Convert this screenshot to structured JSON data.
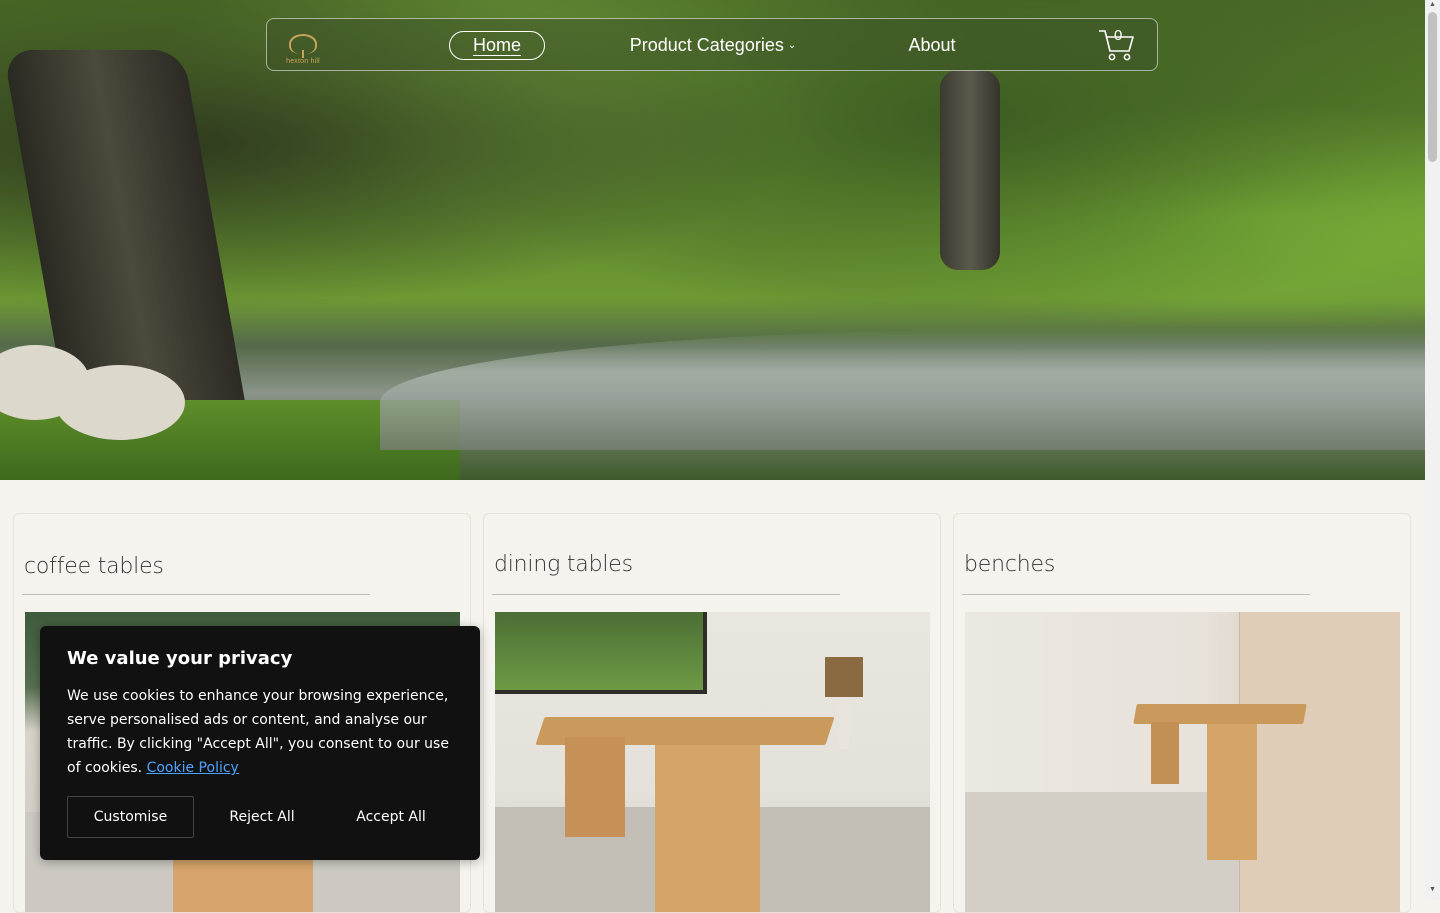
{
  "colors": {
    "background": "#f5f3ee",
    "cookie_bg": "#111111",
    "link": "#4da3ff",
    "logo_gold": "#c8a45a"
  },
  "header": {
    "logo_text": "hexton hill",
    "nav": [
      {
        "label": "Home",
        "active": true
      },
      {
        "label": "Product Categories",
        "has_dropdown": true
      },
      {
        "label": "About"
      }
    ],
    "cart_count": "0",
    "icons": {
      "cart": "cart-icon",
      "dropdown": "chevron-down-icon",
      "logo": "tree-logo-icon"
    }
  },
  "hero": {
    "image": "riverside woodland with sheep"
  },
  "categories": [
    {
      "title": "coffee tables"
    },
    {
      "title": "dining tables"
    },
    {
      "title": "benches"
    }
  ],
  "cookie_banner": {
    "title": "We value your privacy",
    "text": "We use cookies to enhance your browsing experience, serve personalised ads or content, and analyse our traffic. By clicking \"Accept All\", you consent to our use of cookies.",
    "link_text": "Cookie Policy",
    "buttons": {
      "customise": "Customise",
      "reject": "Reject All",
      "accept": "Accept All"
    }
  }
}
